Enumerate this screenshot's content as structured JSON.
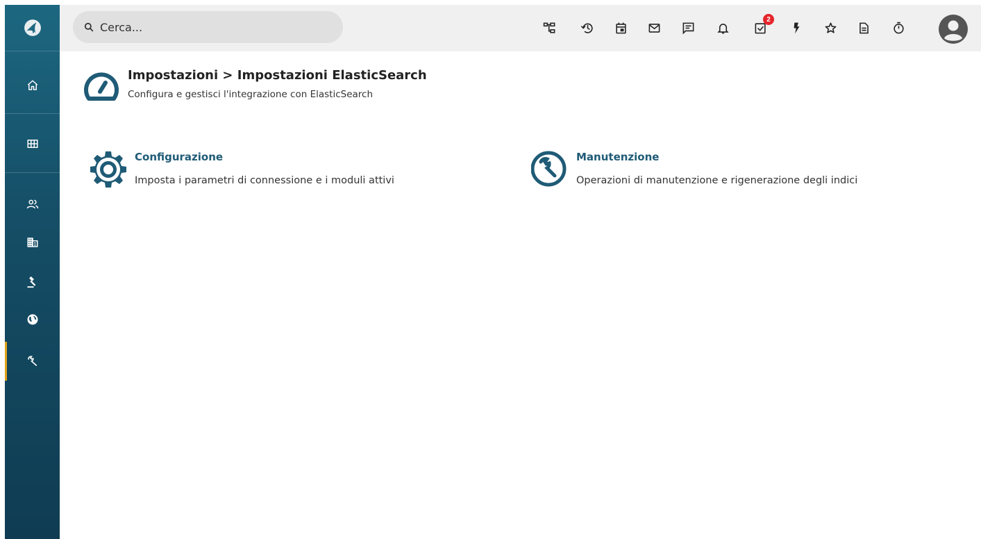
{
  "search": {
    "placeholder": "Cerca..."
  },
  "toolbar": {
    "icons": [
      "sitemap-icon",
      "history-icon",
      "calendar-icon",
      "mail-icon",
      "chat-icon",
      "bell-icon",
      "tasks-icon",
      "flash-icon",
      "star-icon",
      "document-icon",
      "timer-icon"
    ],
    "tasks_badge": "2"
  },
  "sidebar": {
    "items": [
      "logo",
      "home",
      "grid",
      "users",
      "building",
      "gavel",
      "globe",
      "wrench"
    ],
    "active": "wrench",
    "accent": "#e3a21a"
  },
  "header": {
    "title": "Impostazioni > Impostazioni ElasticSearch",
    "subtitle": "Configura e gestisci l'integrazione con ElasticSearch"
  },
  "cards": [
    {
      "title": "Configurazione",
      "description": "Imposta i parametri di connessione e i moduli attivi",
      "icon": "gear-icon"
    },
    {
      "title": "Manutenzione",
      "description": "Operazioni di manutenzione e rigenerazione degli indici",
      "icon": "wrench-icon"
    }
  ],
  "colors": {
    "primary": "#1f5b76",
    "badge": "#e4262c",
    "topbar": "#f0f0f0"
  }
}
